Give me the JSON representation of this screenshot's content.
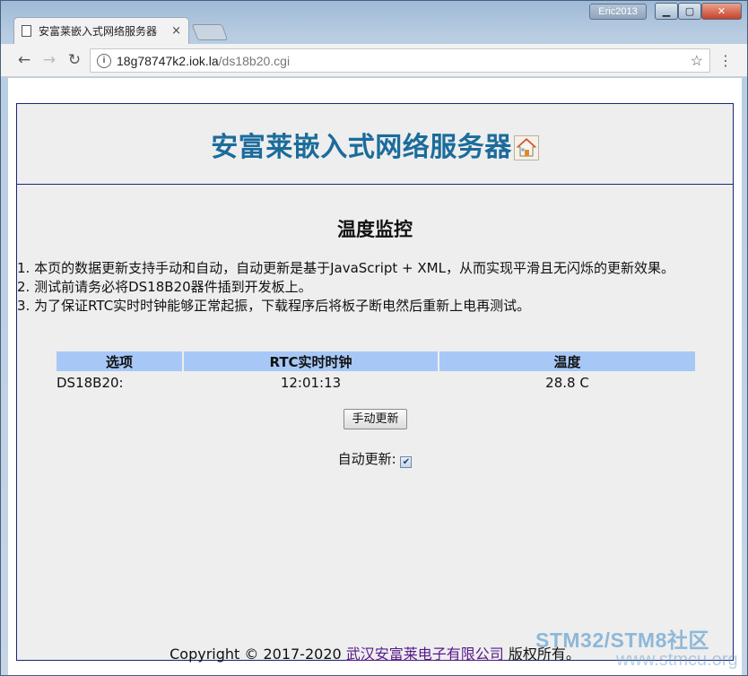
{
  "browser": {
    "tab_title": "安富莱嵌入式网络服务器",
    "tab_close": "×",
    "user_badge": "Eric2013",
    "url_host": "18g78747k2.iok.la",
    "url_path": "/ds18b20.cgi",
    "window_controls": {
      "minimize": "▁",
      "maximize": "▢",
      "close": "✕"
    }
  },
  "page": {
    "header_title": "安富莱嵌入式网络服务器",
    "section_title": "温度监控",
    "notes": [
      "1. 本页的数据更新支持手动和自动，自动更新是基于JavaScript + XML，从而实现平滑且无闪烁的更新效果。",
      "2. 测试前请务必将DS18B20器件插到开发板上。",
      "3. 为了保证RTC实时时钟能够正常起振，下载程序后将板子断电然后重新上电再测试。"
    ],
    "table": {
      "headers": [
        "选项",
        "RTC实时时钟",
        "温度"
      ],
      "row": {
        "label": "DS18B20:",
        "time": "12:01:13",
        "temperature": "28.8 C"
      }
    },
    "manual_button": "手动更新",
    "auto_update_label": "自动更新:",
    "auto_update_checked": true,
    "footer": {
      "prefix": "Copyright © 2017-2020 ",
      "link_text": "武汉安富莱电子有限公司",
      "suffix": " 版权所有。"
    }
  },
  "watermark": {
    "line1": "STM32/STM8社区",
    "line2": "www.stmcu.org"
  },
  "colors": {
    "header_title": "#1b6c9c",
    "table_header_bg": "#a7c8f7",
    "page_border": "#1a237e",
    "link": "#551a8b"
  }
}
